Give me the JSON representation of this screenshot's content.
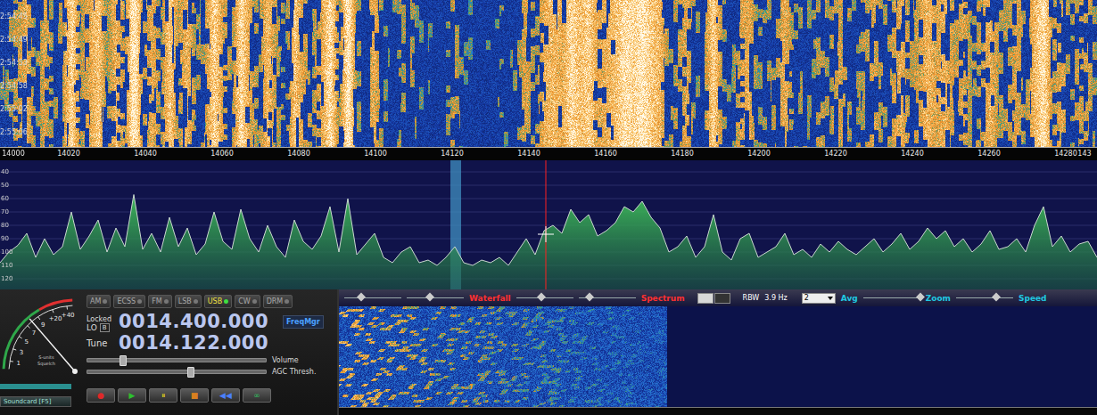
{
  "waterfall": {
    "times": [
      "2:54:45",
      "2:54:49",
      "2:54:53",
      "2:54:58",
      "2:55:02",
      "2:55:06"
    ]
  },
  "frequency_axis": {
    "ticks": [
      "14000",
      "14020",
      "14040",
      "14060",
      "14080",
      "14100",
      "14120",
      "14140",
      "14160",
      "14180",
      "14200",
      "14220",
      "14240",
      "14260",
      "14280",
      "143"
    ]
  },
  "spectrum": {
    "y_ticks": [
      "40",
      "50",
      "60",
      "70",
      "80",
      "90",
      "100",
      "110",
      "120"
    ],
    "series": [
      {
        "name": "signal-level",
        "values": [
          -108,
          -100,
          -95,
          -86,
          -104,
          -90,
          -102,
          -96,
          -70,
          -98,
          -88,
          -76,
          -100,
          -82,
          -96,
          -57,
          -98,
          -86,
          -100,
          -74,
          -96,
          -82,
          -102,
          -94,
          -70,
          -92,
          -98,
          -68,
          -90,
          -100,
          -80,
          -96,
          -104,
          -76,
          -92,
          -98,
          -88,
          -66,
          -100,
          -60,
          -102,
          -94,
          -86,
          -104,
          -108,
          -100,
          -96,
          -108,
          -106,
          -110,
          -104,
          -96,
          -108,
          -110,
          -106,
          -108,
          -104,
          -110,
          -100,
          -90,
          -102,
          -84,
          -80,
          -86,
          -68,
          -78,
          -72,
          -88,
          -84,
          -78,
          -66,
          -70,
          -62,
          -74,
          -82,
          -100,
          -96,
          -88,
          -104,
          -96,
          -72,
          -100,
          -106,
          -90,
          -86,
          -104,
          -100,
          -96,
          -86,
          -102,
          -98,
          -104,
          -94,
          -100,
          -92,
          -98,
          -102,
          -96,
          -90,
          -100,
          -94,
          -86,
          -98,
          -92,
          -82,
          -90,
          -84,
          -96,
          -90,
          -100,
          -94,
          -84,
          -98,
          -96,
          -90,
          -100,
          -80,
          -66,
          -96,
          -88,
          -100,
          -94,
          -92,
          -104
        ]
      }
    ]
  },
  "s_meter": {
    "scale": [
      "+40",
      "+20",
      "9",
      "7",
      "5",
      "3",
      "1"
    ],
    "caption_top": "S-units",
    "caption_bottom": "Squelch",
    "level": 0.55,
    "bar_level": 1
  },
  "modes": [
    {
      "label": "AM",
      "selected": false
    },
    {
      "label": "ECSS",
      "selected": false
    },
    {
      "label": "FM",
      "selected": false
    },
    {
      "label": "LSB",
      "selected": false
    },
    {
      "label": "USB",
      "selected": true
    },
    {
      "label": "CW",
      "selected": false
    },
    {
      "label": "DRM",
      "selected": false
    }
  ],
  "lo": {
    "status": "Locked",
    "label": "LO",
    "bank": "B",
    "frequency": "0014.400.000"
  },
  "freqmgr_button": "FreqMgr",
  "tune": {
    "label": "Tune",
    "frequency": "0014.122.000"
  },
  "sliders": [
    {
      "label": "Volume",
      "level": 0.2
    },
    {
      "label": "AGC Thresh.",
      "level": 0.58
    }
  ],
  "soundcard_button": "Soundcard [F5]",
  "transport": [
    {
      "icon": "●",
      "color": "#e02828"
    },
    {
      "icon": "▶",
      "color": "#2ec02e"
    },
    {
      "icon": "⏸",
      "color": "#d8c820"
    },
    {
      "icon": "■",
      "color": "#d88020"
    },
    {
      "icon": "◀◀",
      "color": "#4a80ff"
    },
    {
      "icon": "∞",
      "color": "#30c060"
    }
  ],
  "toolbar": {
    "items": [
      {
        "kind": "slider",
        "level": 0.3
      },
      {
        "kind": "slider",
        "level": 0.4
      },
      {
        "kind": "label",
        "text": "Waterfall",
        "color": "#ff3030"
      },
      {
        "kind": "slider",
        "level": 0.45
      },
      {
        "kind": "slider",
        "level": 0.2
      },
      {
        "kind": "label",
        "text": "Spectrum",
        "color": "#ff3030"
      },
      {
        "kind": "switch",
        "on": true
      },
      {
        "kind": "label",
        "text": "RBW",
        "color": "#ffffff"
      },
      {
        "kind": "label",
        "text": "3.9 Hz",
        "color": "#ffffff"
      },
      {
        "kind": "dropdown",
        "value": "2"
      },
      {
        "kind": "label",
        "text": "Avg",
        "color": "#20c8e0"
      },
      {
        "kind": "slider",
        "level": 1
      },
      {
        "kind": "label",
        "text": "Zoom",
        "color": "#20c8e0"
      },
      {
        "kind": "slider",
        "level": 0.7
      },
      {
        "kind": "label",
        "text": "Speed",
        "color": "#20c8e0"
      }
    ]
  }
}
